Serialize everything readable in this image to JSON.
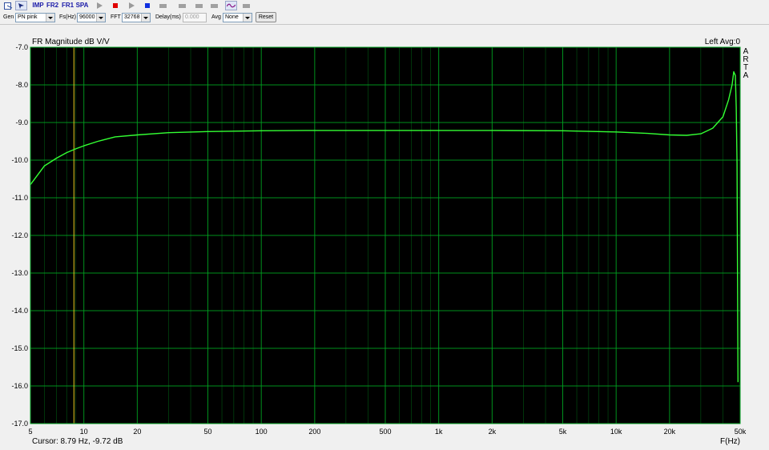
{
  "toolbar": {
    "buttons": [
      {
        "name": "open-icon",
        "label": ""
      },
      {
        "name": "arrow-icon",
        "label": ""
      },
      {
        "name": "imp-button",
        "label": "IMP"
      },
      {
        "name": "fr2-button",
        "label": "FR2"
      },
      {
        "name": "fr1-button",
        "label": "FR1"
      },
      {
        "name": "spa-button",
        "label": "SPA"
      },
      {
        "name": "play-icon",
        "label": ""
      },
      {
        "name": "stop-red-icon",
        "label": ""
      },
      {
        "name": "play2-icon",
        "label": ""
      },
      {
        "name": "stop-blue-icon",
        "label": ""
      },
      {
        "name": "wave-icon",
        "label": ""
      },
      {
        "name": "zoom-icon",
        "label": ""
      },
      {
        "name": "cursor-icon",
        "label": ""
      },
      {
        "name": "bar-icon",
        "label": ""
      },
      {
        "name": "scope-icon",
        "label": ""
      },
      {
        "name": "gray-bar-icon",
        "label": ""
      }
    ]
  },
  "settings": {
    "gen_label": "Gen",
    "gen_value": "PN pink",
    "fs_label": "Fs(Hz)",
    "fs_value": "96000",
    "fft_label": "FFT",
    "fft_value": "32768",
    "delay_label": "Delay(ms)",
    "delay_value": "0.000",
    "avg_label": "Avg",
    "avg_value": "None",
    "reset_label": "Reset"
  },
  "plot": {
    "channel_avg": "Left  Avg:0",
    "side_label": "ARTA",
    "cursor_readout": "Cursor: 8.79 Hz, -9.72 dB",
    "background": "#000000",
    "grid_color": "#00a020",
    "trace_color": "#33ff33",
    "cursor_color": "#e8d020"
  },
  "chart_data": {
    "type": "line",
    "title": "FR Magnitude dB V/V",
    "xlabel": "F(Hz)",
    "ylabel": "",
    "xscale": "log",
    "xlim": [
      5,
      50000
    ],
    "ylim": [
      -17.0,
      -7.0
    ],
    "grid": true,
    "xticks": [
      {
        "value": 5,
        "label": "5"
      },
      {
        "value": 10,
        "label": "10"
      },
      {
        "value": 20,
        "label": "20"
      },
      {
        "value": 50,
        "label": "50"
      },
      {
        "value": 100,
        "label": "100"
      },
      {
        "value": 200,
        "label": "200"
      },
      {
        "value": 500,
        "label": "500"
      },
      {
        "value": 1000,
        "label": "1k"
      },
      {
        "value": 2000,
        "label": "2k"
      },
      {
        "value": 5000,
        "label": "5k"
      },
      {
        "value": 10000,
        "label": "10k"
      },
      {
        "value": 20000,
        "label": "20k"
      },
      {
        "value": 50000,
        "label": "50k"
      }
    ],
    "yticks": [
      {
        "value": -7.0,
        "label": "-7.0"
      },
      {
        "value": -8.0,
        "label": "-8.0"
      },
      {
        "value": -9.0,
        "label": "-9.0"
      },
      {
        "value": -10.0,
        "label": "-10.0"
      },
      {
        "value": -11.0,
        "label": "-11.0"
      },
      {
        "value": -12.0,
        "label": "-12.0"
      },
      {
        "value": -13.0,
        "label": "-13.0"
      },
      {
        "value": -14.0,
        "label": "-14.0"
      },
      {
        "value": -15.0,
        "label": "-15.0"
      },
      {
        "value": -16.0,
        "label": "-16.0"
      },
      {
        "value": -17.0,
        "label": "-17.0"
      }
    ],
    "cursor_x": 8.79,
    "x": [
      5,
      6,
      7,
      8,
      9,
      10,
      12,
      15,
      20,
      30,
      50,
      100,
      200,
      500,
      1000,
      2000,
      5000,
      10000,
      15000,
      20000,
      25000,
      30000,
      35000,
      40000,
      43000,
      45000,
      46000,
      47000,
      47500,
      48000,
      48300,
      48600
    ],
    "values": [
      -10.65,
      -10.15,
      -9.95,
      -9.8,
      -9.7,
      -9.62,
      -9.5,
      -9.38,
      -9.33,
      -9.27,
      -9.24,
      -9.22,
      -9.21,
      -9.21,
      -9.21,
      -9.21,
      -9.22,
      -9.25,
      -9.29,
      -9.33,
      -9.34,
      -9.3,
      -9.15,
      -8.85,
      -8.4,
      -8.0,
      -7.65,
      -7.75,
      -8.6,
      -10.1,
      -13.0,
      -15.9
    ]
  }
}
